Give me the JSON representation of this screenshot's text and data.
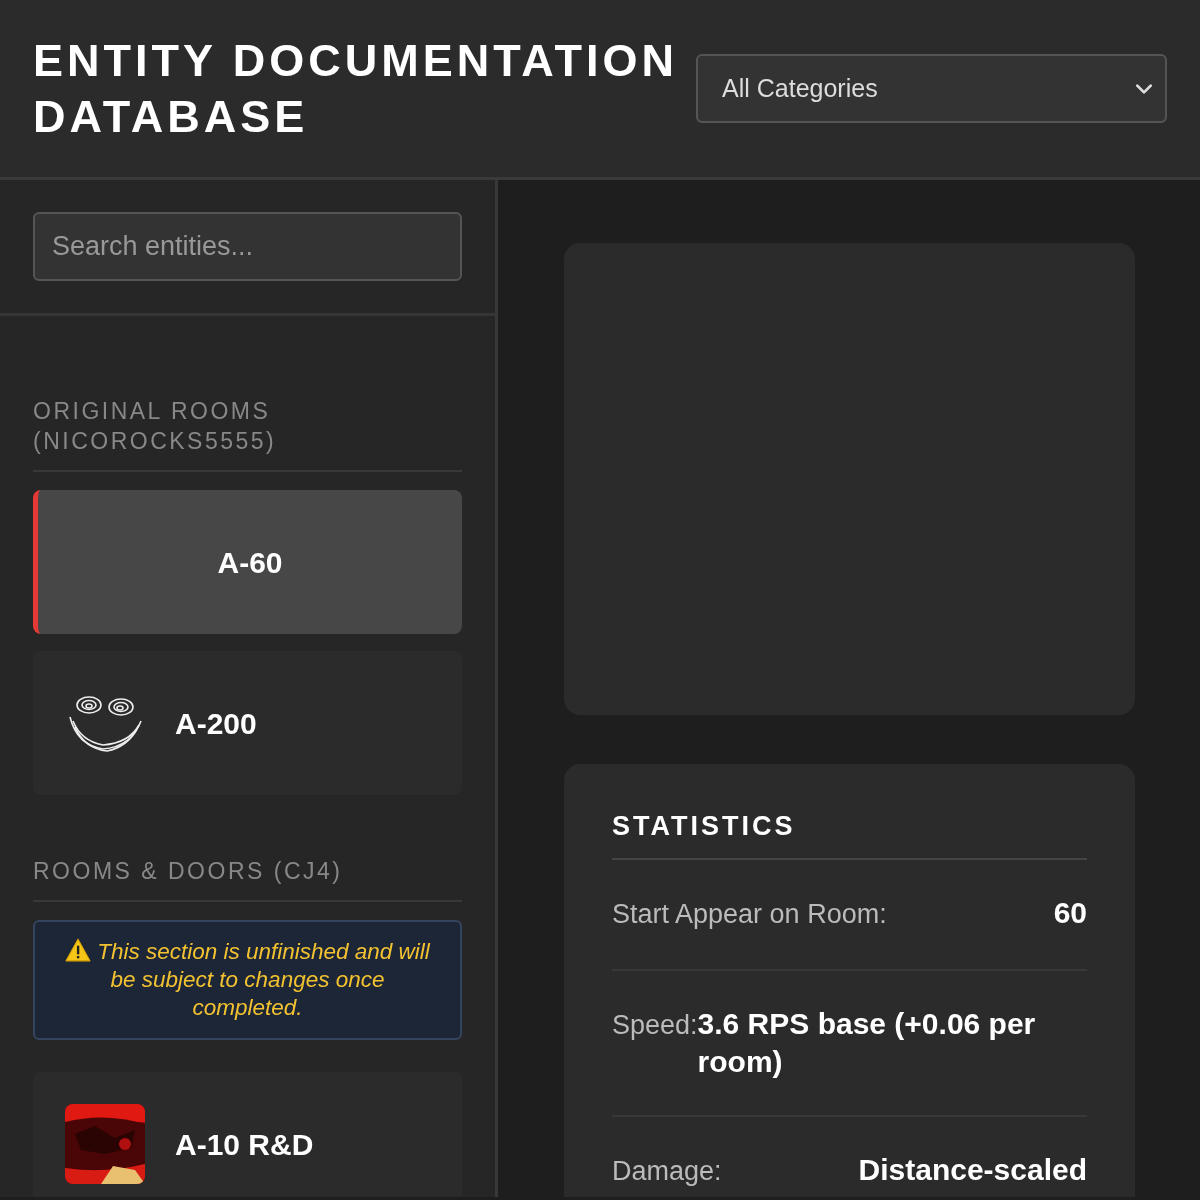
{
  "header": {
    "title": "ENTITY DOCUMENTATION DATABASE",
    "category_select": {
      "value": "All Categories"
    }
  },
  "sidebar": {
    "search": {
      "placeholder": "Search entities..."
    },
    "groups": [
      {
        "title": "ORIGINAL ROOMS (NICOROCKS5555)",
        "items": [
          {
            "name": "A-60",
            "kind": "plain",
            "selected": true
          },
          {
            "name": "A-200",
            "kind": "face",
            "selected": false
          }
        ]
      },
      {
        "title": "ROOMS & DOORS (CJ4)",
        "notice": "This section is unfinished and will be subject to changes once completed.",
        "items": [
          {
            "name": "A-10 R&D",
            "kind": "picture",
            "selected": false
          }
        ]
      }
    ]
  },
  "detail": {
    "statistics": {
      "title": "STATISTICS",
      "rows": [
        {
          "label": "Start Appear on Room:",
          "value": "60"
        },
        {
          "label": "Speed:",
          "value": "3.6 RPS base (+0.06 per room)"
        },
        {
          "label": "Damage:",
          "value": "Distance-scaled"
        }
      ]
    }
  }
}
